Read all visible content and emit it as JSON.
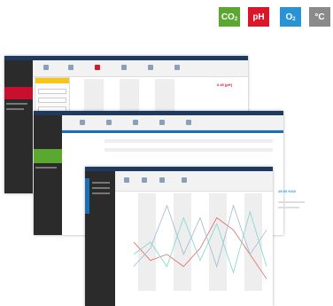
{
  "badges": [
    {
      "main": "CO",
      "sub": "2",
      "color": "#5aa830"
    },
    {
      "main": "pH",
      "sub": "",
      "color": "#d9162a"
    },
    {
      "main": "O",
      "sub": "2",
      "color": "#2a93d5"
    },
    {
      "main": "°C",
      "sub": "",
      "color": "#8a8a8a"
    }
  ],
  "colors": {
    "window_titlebar": "#1e3a5f",
    "sidebar_dark": "#2b2b2b",
    "sidebar_red": "#c8102e",
    "sidebar_green": "#5aa830",
    "sidebar_blue": "#1a6fb5",
    "settings_yellow": "#f5c518"
  },
  "window1": {
    "reading": "6.45 [pH]",
    "reading_color": "#d9162a"
  },
  "window3": {
    "side_reading": "19.03 %O2",
    "side_reading_color": "#2a93d5"
  },
  "chart_data": {
    "type": "line",
    "title": "",
    "xlabel": "",
    "ylabel": "",
    "x": [
      0,
      1,
      2,
      3,
      4,
      5,
      6,
      7,
      8
    ],
    "series": [
      {
        "values": [
          40,
          25,
          30,
          20,
          35,
          60,
          50,
          30,
          10
        ],
        "color": "#e06666"
      },
      {
        "values": [
          20,
          35,
          70,
          30,
          60,
          20,
          70,
          30,
          50
        ],
        "color": "#9fb9cf"
      },
      {
        "values": [
          30,
          40,
          20,
          60,
          25,
          55,
          15,
          65,
          20
        ],
        "color": "#7fd6cc"
      }
    ],
    "ylim": [
      0,
      80
    ]
  }
}
